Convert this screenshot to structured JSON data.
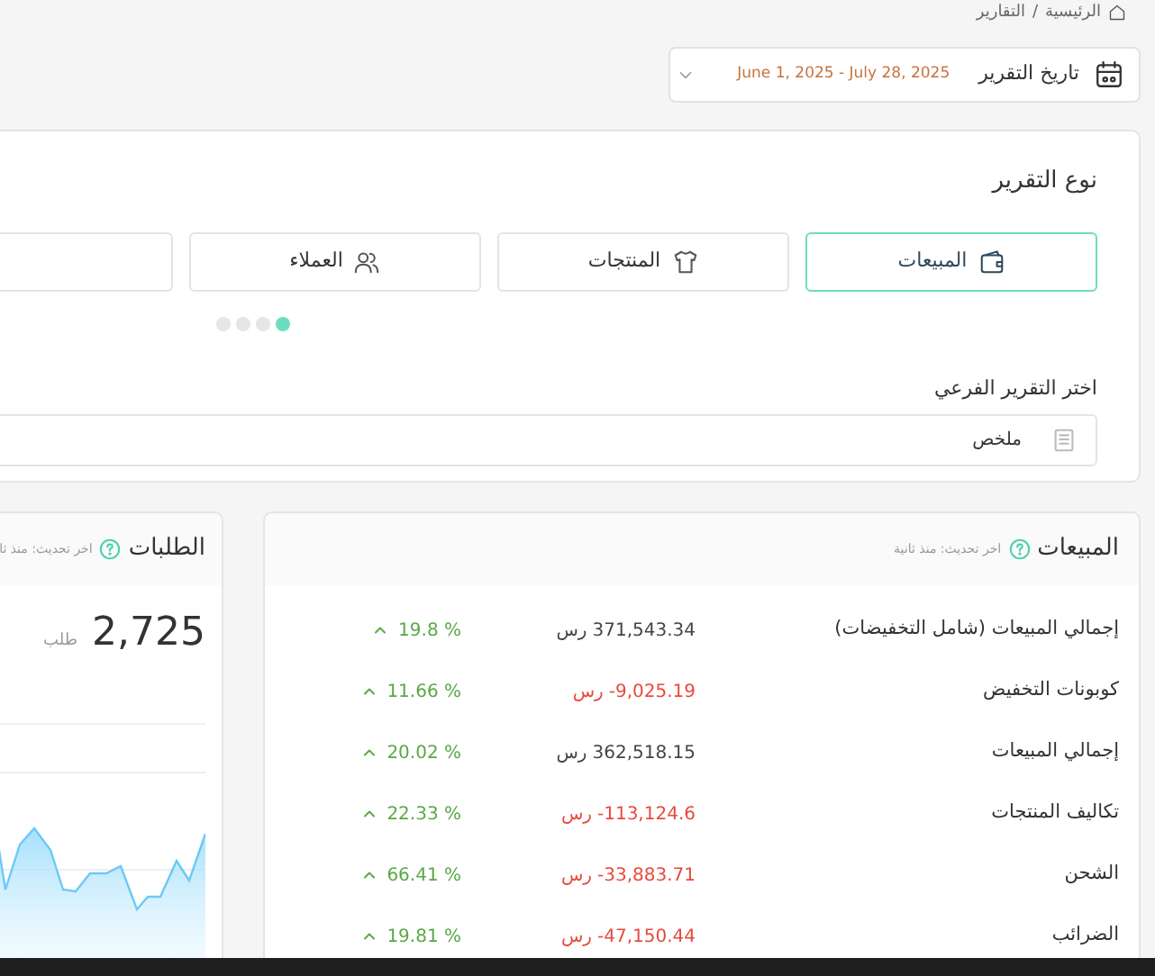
{
  "breadcrumb": [
    {
      "label": "الرئيسية"
    },
    {
      "separator": "/",
      "label": "التقارير"
    }
  ],
  "date_filter": {
    "label": "تاريخ التقرير",
    "value": "June 1, 2025 - July 28, 2025"
  },
  "report_type": {
    "title": "نوع التقرير",
    "tabs": [
      {
        "kind": "sales",
        "label": "المبيعات",
        "selected": true
      },
      {
        "kind": "products",
        "label": "المنتجات",
        "selected": false
      },
      {
        "kind": "customers",
        "label": "العملاء",
        "selected": false
      },
      {
        "kind": "hidden",
        "selected": false
      }
    ],
    "pager": [
      {
        "selected": true
      },
      {
        "selected": false
      },
      {
        "selected": false
      },
      {
        "selected": false
      }
    ]
  },
  "subreport": {
    "label": "اختر التقرير الفرعي",
    "value": "ملخص"
  },
  "sales_card": {
    "title": "المبيعات",
    "updated": "اخر تحديث: منذ ثانية",
    "rows": [
      {
        "label": "إجمالي المبيعات (شامل التخفيضات)",
        "amount": "371,543.34",
        "currency": "رس",
        "negative": false,
        "change": "19.8 %",
        "rising": true
      },
      {
        "label": "كوبونات التخفيض",
        "amount": "-9,025.19",
        "currency": "رس",
        "negative": true,
        "change": "11.66 %",
        "rising": true
      },
      {
        "label": "إجمالي المبيعات",
        "amount": "362,518.15",
        "currency": "رس",
        "negative": false,
        "change": "20.02 %",
        "rising": true
      },
      {
        "label": "تكاليف المنتجات",
        "amount": "-113,124.6",
        "currency": "رس",
        "negative": true,
        "change": "22.33 %",
        "rising": true
      },
      {
        "label": "الشحن",
        "amount": "-33,883.71",
        "currency": "رس",
        "negative": true,
        "change": "66.41 %",
        "rising": true
      },
      {
        "label": "الضرائب",
        "amount": "-47,150.44",
        "currency": "رس",
        "negative": true,
        "change": "19.81 %",
        "rising": true
      }
    ]
  },
  "orders_card": {
    "title": "الطلبات",
    "updated": "اخر تحديث: منذ ثا",
    "value": "2,725",
    "unit": "طلب"
  }
}
